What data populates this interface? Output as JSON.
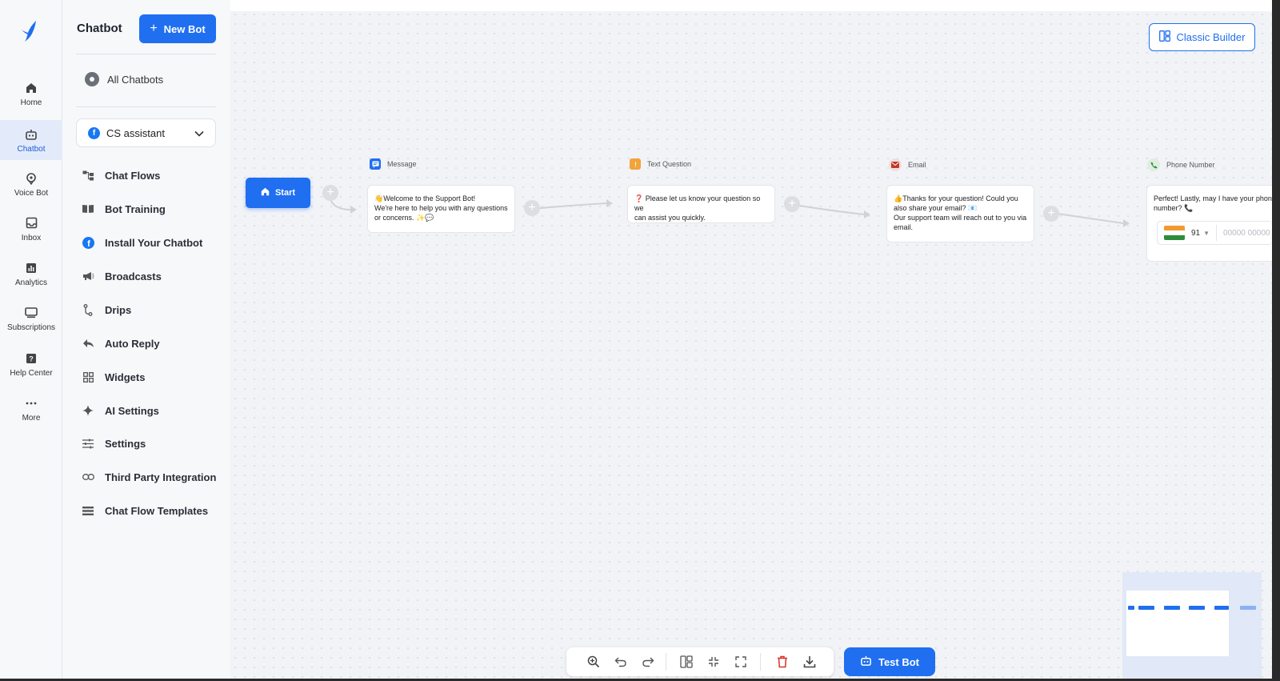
{
  "rail": {
    "items": [
      {
        "label": "Home",
        "icon": "home-icon"
      },
      {
        "label": "Chatbot",
        "icon": "bot-icon",
        "active": true
      },
      {
        "label": "Voice Bot",
        "icon": "voice-bot-icon"
      },
      {
        "label": "Inbox",
        "icon": "inbox-icon"
      },
      {
        "label": "Analytics",
        "icon": "analytics-icon"
      },
      {
        "label": "Subscriptions",
        "icon": "subscriptions-icon"
      },
      {
        "label": "Help Center",
        "icon": "help-icon"
      },
      {
        "label": "More",
        "icon": "more-icon"
      }
    ]
  },
  "sidebar": {
    "title": "Chatbot",
    "new_bot_label": "New Bot",
    "all_chatbots_label": "All Chatbots",
    "selected_bot": "CS assistant",
    "menu": [
      {
        "label": "Chat Flows",
        "icon": "flow-icon"
      },
      {
        "label": "Bot Training",
        "icon": "book-icon"
      },
      {
        "label": "Install Your Chatbot",
        "icon": "facebook-icon"
      },
      {
        "label": "Broadcasts",
        "icon": "megaphone-icon"
      },
      {
        "label": "Drips",
        "icon": "drip-icon"
      },
      {
        "label": "Auto Reply",
        "icon": "reply-icon"
      },
      {
        "label": "Widgets",
        "icon": "widgets-icon"
      },
      {
        "label": "AI Settings",
        "icon": "sparkle-icon"
      },
      {
        "label": "Settings",
        "icon": "sliders-icon"
      },
      {
        "label": "Third Party Integration",
        "icon": "link-icon"
      },
      {
        "label": "Chat Flow Templates",
        "icon": "templates-icon"
      }
    ]
  },
  "canvas": {
    "classic_builder_label": "Classic Builder",
    "start_label": "Start",
    "nodes": [
      {
        "type_label": "Message",
        "lines": [
          "👋Welcome to the Support Bot!",
          "We're here to help you with any questions",
          "or concerns. ✨💬"
        ]
      },
      {
        "type_label": "Text Question",
        "lines": [
          "❓ Please let us know your question so we",
          "can assist you quickly."
        ]
      },
      {
        "type_label": "Email",
        "lines": [
          "👍Thanks for your question! Could you",
          "also share your email? 📧",
          "Our support team will reach out to you via",
          "email."
        ]
      },
      {
        "type_label": "Phone Number",
        "lines": [
          "Perfect! Lastly, may I have your phone",
          "number? 📞"
        ],
        "country_code": "91",
        "phone_placeholder": "00000 00000"
      }
    ]
  },
  "toolbar": {
    "test_bot_label": "Test Bot"
  },
  "colors": {
    "accent": "#1f6ff0",
    "delete": "#d93025"
  }
}
